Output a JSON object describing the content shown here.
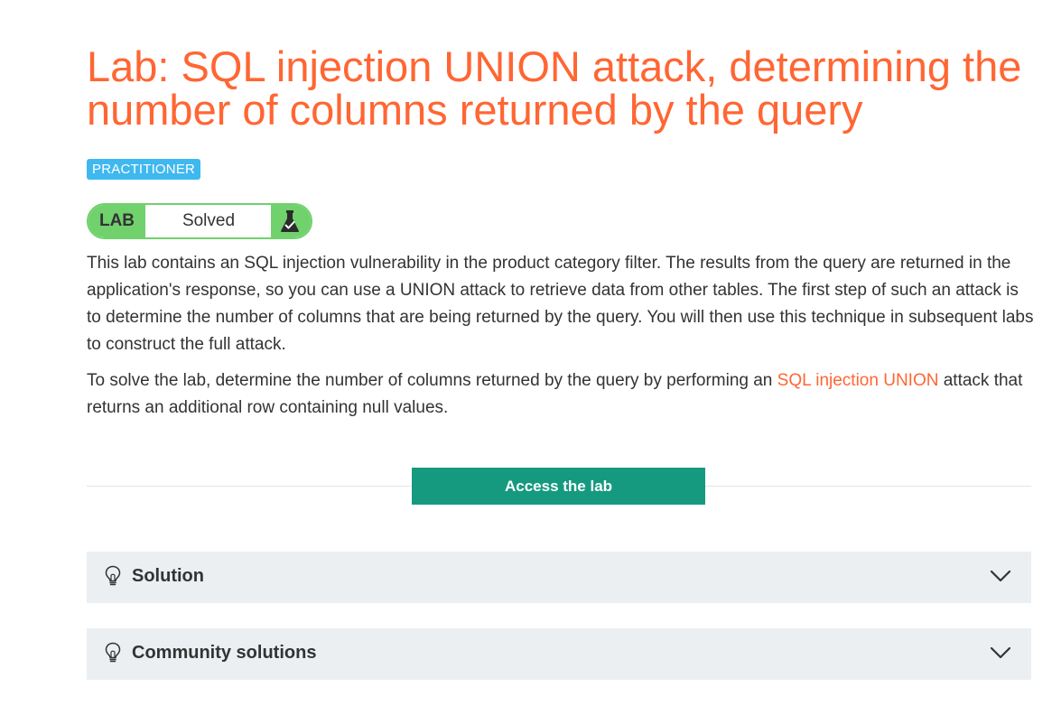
{
  "lab": {
    "title": "Lab: SQL injection UNION attack, determining the number of columns returned by the query",
    "level": "PRACTITIONER",
    "status_widget": {
      "tag": "LAB",
      "status": "Solved",
      "icon": "flask-solved-icon"
    },
    "description": {
      "paragraph1": "This lab contains an SQL injection vulnerability in the product category filter. The results from the query are returned in the application's response, so you can use a UNION attack to retrieve data from other tables. The first step of such an attack is to determine the number of columns that are being returned by the query. You will then use this technique in subsequent labs to construct the full attack.",
      "paragraph2_before": "To solve the lab, determine the number of columns returned by the query by performing an ",
      "paragraph2_link": "SQL injection UNION",
      "paragraph2_after": " attack that returns an additional row containing null values."
    },
    "access_button": "Access the lab"
  },
  "accordions": [
    {
      "label": "Solution",
      "icon": "lightbulb-icon",
      "expand_icon": "chevron-down-icon"
    },
    {
      "label": "Community solutions",
      "icon": "lightbulb-icon",
      "expand_icon": "chevron-down-icon"
    }
  ],
  "colors": {
    "title": "#ff6633",
    "level_badge": "#3fb8f0",
    "status_green": "#70d16d",
    "button": "#159a80",
    "accordion_bg": "#ebeff2",
    "link": "#ff6633"
  }
}
